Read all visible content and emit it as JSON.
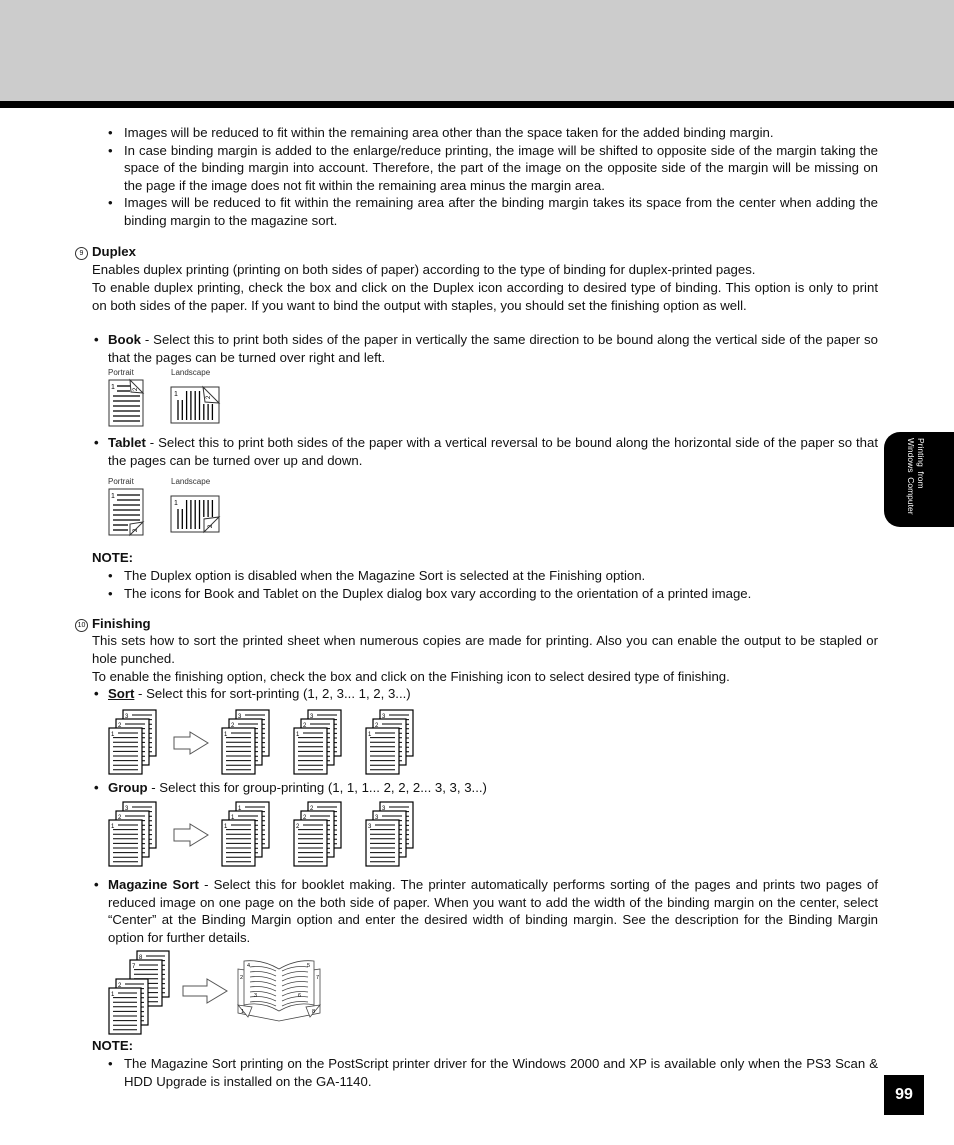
{
  "page": {
    "number": "99",
    "side_tab": "Printing  from\nWindows  Computer"
  },
  "intro_bullets": [
    "Images will be reduced to fit  within the remaining area other than the space taken for the added binding margin.",
    "In case binding margin is added to the enlarge/reduce printing, the image will be shifted to opposite side of the margin taking the space of the binding margin into account.  Therefore, the part of the image on the opposite side of the margin will be missing on the page if the image does not fit within the remaining area minus the margin area.",
    "Images will be reduced to fit within the remaining area after the binding margin takes its space from the center when adding the binding margin to the magazine sort."
  ],
  "duplex": {
    "number": "9",
    "title": "Duplex",
    "para1": "Enables duplex printing (printing on both sides of paper) according to the type of binding for duplex-printed pages.",
    "para2": "To enable duplex printing, check the box and click on the Duplex icon according to desired type of binding.  This option is only to print on both sides of the paper.  If you want to bind the output with staples, you should set the finishing option as well.",
    "book": {
      "label": "Book",
      "text": " - Select this to print both sides of the paper in vertically the same direction to be bound along the vertical side of the paper so that the pages can be turned over right and left.",
      "caption_portrait": "Portrait",
      "caption_landscape": "Landscape"
    },
    "tablet": {
      "label": "Tablet",
      "text": " - Select this to print both sides of the paper with a vertical reversal to be bound along the horizontal side of the paper so that the pages can be turned over up and down.",
      "caption_portrait": "Portrait",
      "caption_landscape": "Landscape"
    },
    "note_label": "NOTE:",
    "notes": [
      "The Duplex option is disabled when the Magazine Sort is selected at the Finishing option.",
      "The icons for Book and Tablet on the Duplex dialog box vary according to the orientation of a printed image."
    ]
  },
  "finishing": {
    "number": "10",
    "title": "Finishing",
    "para1": "This sets how to sort the printed sheet when numerous copies are made for printing.  Also you can enable the output to be stapled or hole punched.",
    "para2": "To enable the finishing option, check the box and click on the Finishing icon to select desired type of finishing.",
    "sort": {
      "label": "Sort",
      "text": " - Select this for sort-printing (1, 2, 3... 1, 2, 3...)",
      "input_stack": [
        "1",
        "2",
        "3"
      ],
      "output_stacks": [
        [
          "1",
          "2",
          "3"
        ],
        [
          "1",
          "2",
          "3"
        ],
        [
          "1",
          "2",
          "3"
        ]
      ]
    },
    "group": {
      "label": "Group",
      "text": " - Select this for group-printing (1, 1, 1... 2, 2, 2... 3, 3, 3...)",
      "input_stack": [
        "1",
        "2",
        "3"
      ],
      "output_stacks": [
        [
          "1",
          "1",
          "1"
        ],
        [
          "2",
          "2",
          "2"
        ],
        [
          "3",
          "3",
          "3"
        ]
      ]
    },
    "magazine": {
      "label": "Magazine Sort",
      "text": " - Select this for booklet making.  The printer automatically performs sorting of the pages and prints two pages of reduced image on one page on the both side of paper.  When you want to add the width of the binding margin on the center, select “Center” at the Binding Margin option and enter the desired width of binding margin.  See the description for the Binding Margin option for further details.",
      "input_pages": [
        "1",
        "2",
        "7",
        "8"
      ],
      "booklet_pages": [
        "1",
        "2",
        "3",
        "4",
        "5",
        "6",
        "7",
        "8"
      ]
    },
    "note_label": "NOTE:",
    "notes": [
      "The Magazine Sort printing on the PostScript printer driver for the Windows 2000 and XP is available only when the PS3 Scan & HDD Upgrade is installed on the GA-1140."
    ]
  }
}
